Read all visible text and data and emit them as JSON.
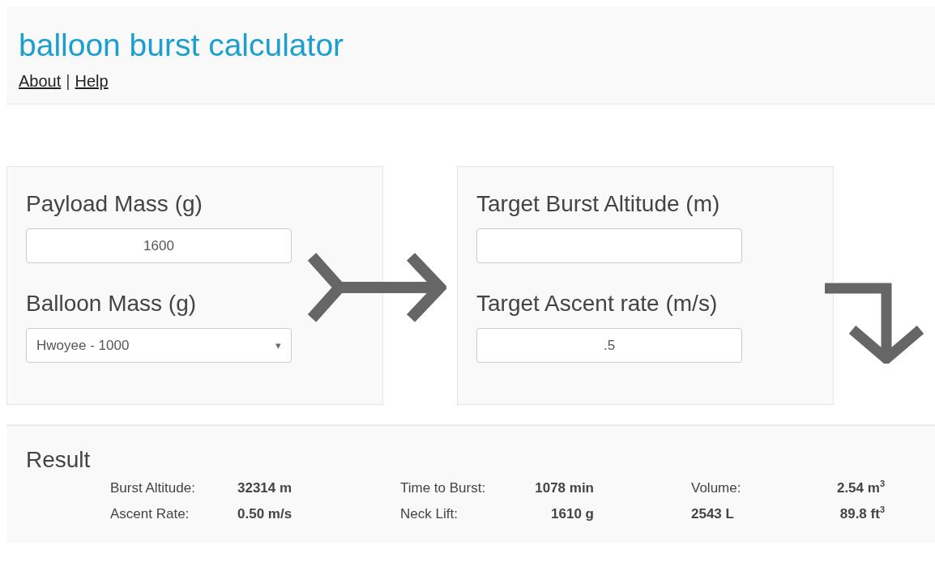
{
  "header": {
    "title": "balloon burst calculator",
    "links": [
      {
        "label": "About"
      },
      {
        "label": "Help"
      }
    ],
    "separator": "|"
  },
  "inputs": {
    "fields": [
      {
        "kind": "text",
        "label": "Payload Mass (g)",
        "value": "1600"
      },
      {
        "kind": "select",
        "label": "Balloon Mass (g)",
        "value": "Hwoyee - 1000",
        "caret": "▾"
      }
    ]
  },
  "targets": {
    "fields": [
      {
        "kind": "text",
        "label": "Target Burst Altitude (m)"
      },
      {
        "kind": "text",
        "label": "Target Ascent rate (m/s)",
        "value": ".5"
      }
    ]
  },
  "result": {
    "title": "Result",
    "columns": [
      {
        "rows": [
          {
            "label": "Burst Altitude:",
            "value": "32314 m",
            "emphasis": false
          },
          {
            "label": "Ascent Rate:",
            "value": "0.50 m/s",
            "emphasis": false
          }
        ]
      },
      {
        "rows": [
          {
            "label": "Time to Burst:",
            "value": "1078 min",
            "emphasis": false
          },
          {
            "label": "Neck Lift:",
            "value": "1610 g",
            "emphasis": false
          }
        ]
      },
      {
        "rows": [
          {
            "label": "Volume:",
            "value": "2.54 m$^{3}$",
            "emphasis": false
          },
          {
            "label": "2543 L",
            "value": "89.8 ft$^{3}$",
            "emphasis": true
          }
        ]
      }
    ]
  }
}
